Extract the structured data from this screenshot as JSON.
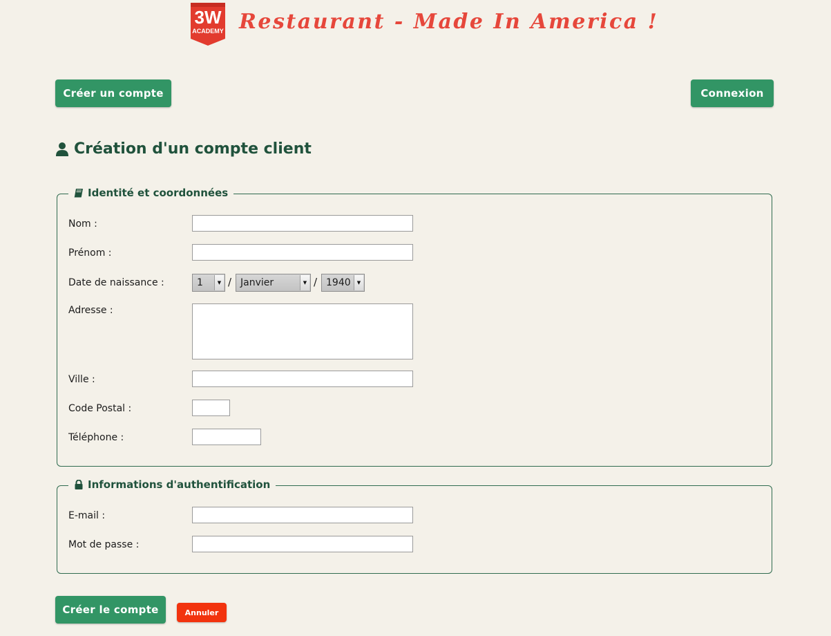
{
  "header": {
    "logo_text": "3W ACADEMY",
    "title": "Restaurant - Made In America !"
  },
  "nav": {
    "create_account_label": "Créer un compte",
    "login_label": "Connexion"
  },
  "page": {
    "title": "Création d'un compte client"
  },
  "identity": {
    "legend": "Identité et coordonnées",
    "last_name_label": "Nom :",
    "last_name_value": "",
    "first_name_label": "Prénom :",
    "first_name_value": "",
    "birthdate_label": "Date de naissance :",
    "birth_day": "1",
    "birth_month": "Janvier",
    "birth_year": "1940",
    "date_separator": "/",
    "address_label": "Adresse :",
    "address_value": "",
    "city_label": "Ville :",
    "city_value": "",
    "postal_code_label": "Code Postal :",
    "postal_code_value": "",
    "phone_label": "Téléphone :",
    "phone_value": ""
  },
  "auth": {
    "legend": "Informations d'authentification",
    "email_label": "E-mail :",
    "email_value": "",
    "password_label": "Mot de passe :",
    "password_value": ""
  },
  "actions": {
    "submit_label": "Créer le compte",
    "cancel_label": "Annuler"
  },
  "colors": {
    "background": "#f4f1e9",
    "title_red": "#e6473b",
    "button_green": "#329565",
    "heading_green": "#20523c",
    "cancel_red": "#f2330e"
  },
  "icons": {
    "page_title": "user-icon",
    "identity_legend": "book-icon",
    "auth_legend": "lock-icon",
    "select_arrow": "chevron-down-icon"
  }
}
